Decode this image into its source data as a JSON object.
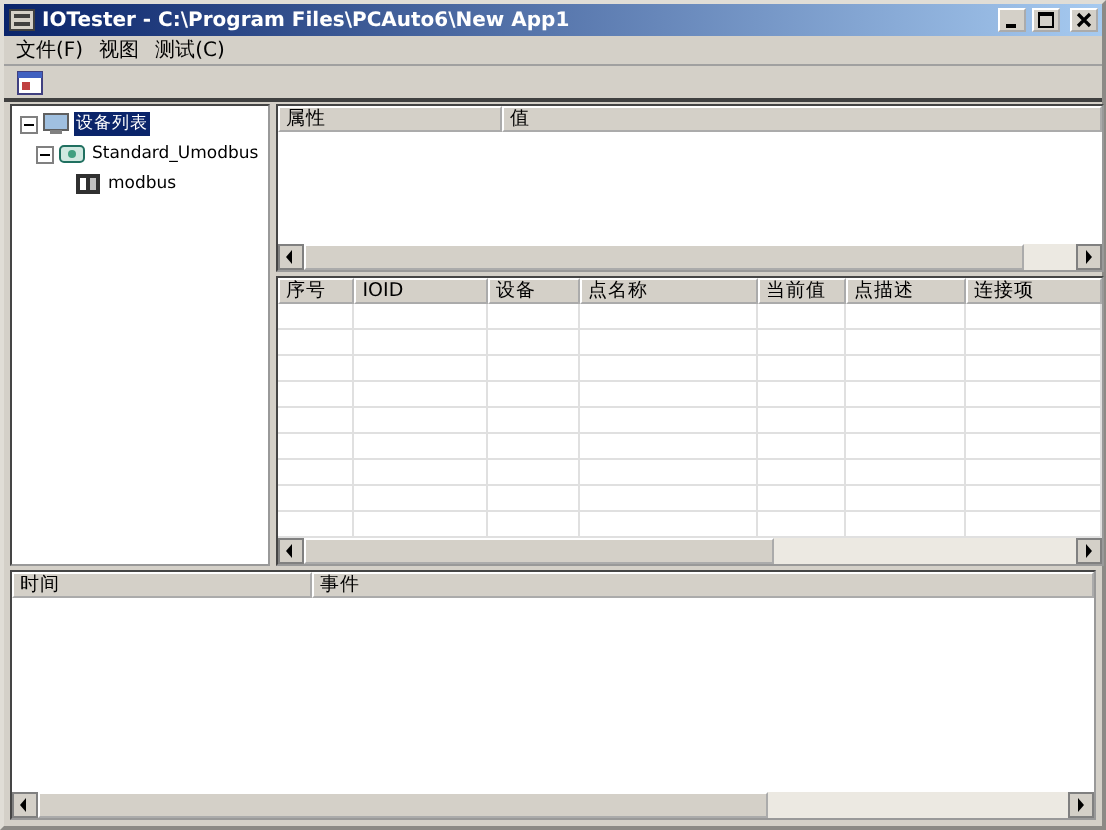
{
  "window": {
    "title": "IOTester - C:\\Program Files\\PCAuto6\\New App1"
  },
  "menu": [
    "文件(F)",
    "视图",
    "测试(C)"
  ],
  "tree": [
    {
      "label": "设备列表",
      "selected": true,
      "expanded": true,
      "children": [
        {
          "label": "Standard_Umodbus",
          "selected": false,
          "expanded": true,
          "children": [
            {
              "label": "modbus",
              "selected": false
            }
          ]
        }
      ]
    }
  ],
  "properties": {
    "columns": [
      "属性",
      "值"
    ]
  },
  "points": {
    "columns": [
      "序号",
      "IOID",
      "设备",
      "点名称",
      "当前值",
      "点描述",
      "连接项"
    ]
  },
  "log": {
    "columns": [
      "时间",
      "事件"
    ]
  }
}
